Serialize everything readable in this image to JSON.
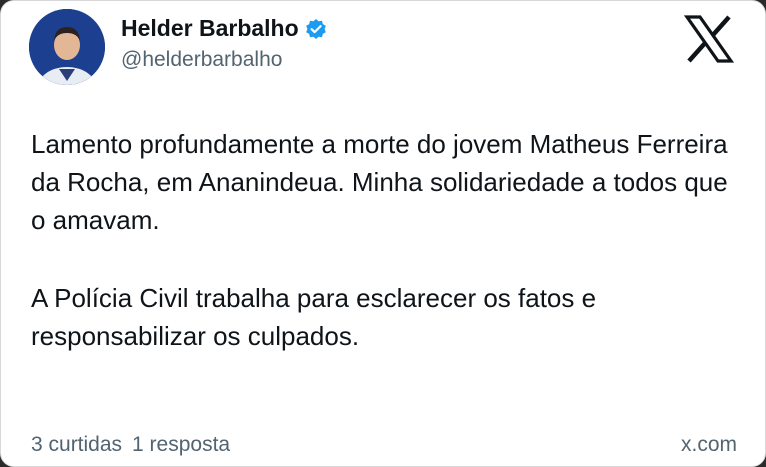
{
  "author": {
    "name": "Helder Barbalho",
    "handle": "@helderbarbalho",
    "verified": true,
    "verified_color": "#1d9bf0"
  },
  "brand": {
    "logo_icon": "x-logo-icon",
    "site": "x.com"
  },
  "tweet": {
    "paragraphs": [
      "Lamento profundamente a morte do jovem Matheus Ferreira da Rocha, em Ananindeua. Minha solidariedade a todos que o amavam.",
      "A Polícia Civil trabalha para esclarecer os fatos e responsabilizar os culpados."
    ]
  },
  "stats": {
    "likes": "3 curtidas",
    "replies": "1 resposta"
  }
}
